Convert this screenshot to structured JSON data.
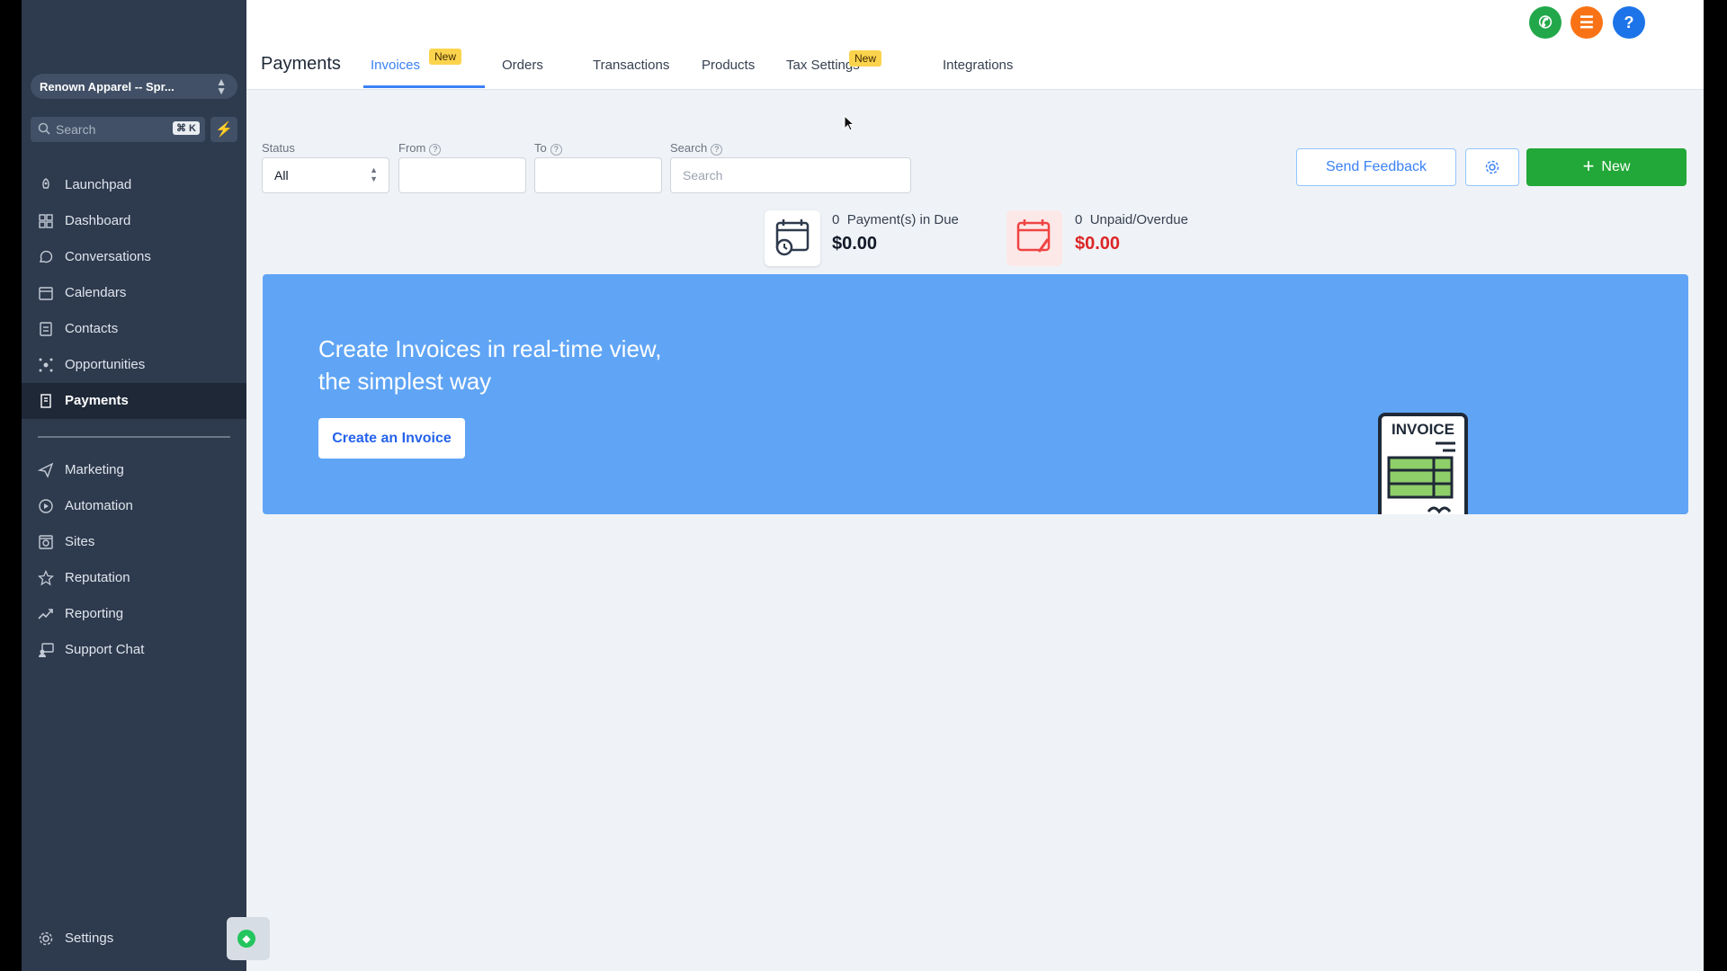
{
  "sidebar": {
    "account_name": "Renown Apparel -- Spr...",
    "search_placeholder": "Search",
    "search_shortcut": "⌘ K",
    "items": [
      {
        "label": "Launchpad",
        "icon": "rocket-icon"
      },
      {
        "label": "Dashboard",
        "icon": "dashboard-icon"
      },
      {
        "label": "Conversations",
        "icon": "chat-icon"
      },
      {
        "label": "Calendars",
        "icon": "calendar-icon"
      },
      {
        "label": "Contacts",
        "icon": "contacts-icon"
      },
      {
        "label": "Opportunities",
        "icon": "opportunities-icon"
      },
      {
        "label": "Payments",
        "icon": "receipt-icon"
      },
      {
        "label": "Marketing",
        "icon": "send-icon"
      },
      {
        "label": "Automation",
        "icon": "automation-icon"
      },
      {
        "label": "Sites",
        "icon": "sites-icon"
      },
      {
        "label": "Reputation",
        "icon": "star-icon"
      },
      {
        "label": "Reporting",
        "icon": "trend-icon"
      },
      {
        "label": "Support Chat",
        "icon": "support-icon"
      }
    ],
    "settings_label": "Settings",
    "active_item": "Payments"
  },
  "header": {
    "title": "Payments",
    "tabs": [
      {
        "label": "Invoices",
        "badge": "New"
      },
      {
        "label": "Orders"
      },
      {
        "label": "Transactions"
      },
      {
        "label": "Products"
      },
      {
        "label": "Tax Settings",
        "badge": "New"
      },
      {
        "label": "Integrations"
      }
    ],
    "active_tab": "Invoices"
  },
  "filters": {
    "status_label": "Status",
    "status_value": "All",
    "from_label": "From",
    "to_label": "To",
    "search_label": "Search",
    "search_placeholder": "Search"
  },
  "actions": {
    "feedback": "Send Feedback",
    "new": "New"
  },
  "stats": {
    "due_count": "0",
    "due_label": "Payment(s) in Due",
    "due_amount": "$0.00",
    "overdue_count": "0",
    "overdue_label": "Unpaid/Overdue",
    "overdue_amount": "$0.00"
  },
  "banner": {
    "line1": "Create Invoices in real-time view,",
    "line2": "the simplest way",
    "button": "Create an Invoice",
    "illustration_text": "INVOICE"
  },
  "colors": {
    "sidebar": "#2e3a4d",
    "accent": "#3b82f6",
    "banner": "#60a5f5",
    "new_button": "#22a838",
    "overdue": "#dc2626",
    "badge": "#fcd34d"
  }
}
